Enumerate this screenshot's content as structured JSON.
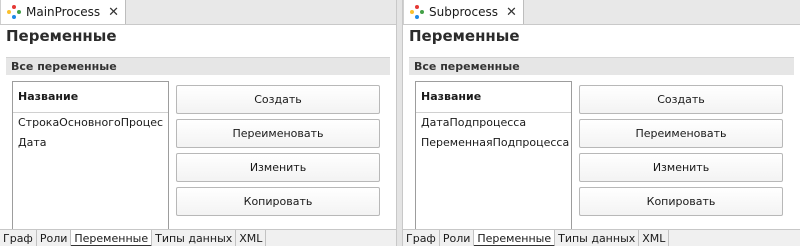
{
  "panes": {
    "left": {
      "tab_title": "MainProcess",
      "close_glyph": "✕",
      "section_title": "Переменные",
      "group_title": "Все переменные",
      "table": {
        "header": "Название",
        "rows": [
          "СтрокаОсновногоПроцес",
          "Дата"
        ]
      },
      "buttons": [
        "Создать",
        "Переименовать",
        "Изменить",
        "Копировать"
      ],
      "bottom_tabs": [
        "Граф",
        "Роли",
        "Переменные",
        "Типы данных",
        "XML"
      ],
      "active_bottom_tab": "Переменные"
    },
    "right": {
      "tab_title": "Subprocess",
      "close_glyph": "✕",
      "section_title": "Переменные",
      "group_title": "Все переменные",
      "table": {
        "header": "Название",
        "rows": [
          "ДатаПодпроцесса",
          "ПеременнаяПодпроцесса"
        ]
      },
      "buttons": [
        "Создать",
        "Переименовать",
        "Изменить",
        "Копировать"
      ],
      "bottom_tabs": [
        "Граф",
        "Роли",
        "Переменные",
        "Типы данных",
        "XML"
      ],
      "active_bottom_tab": "Переменные"
    }
  },
  "icons": {
    "tab": "process-icon",
    "close": "close-icon"
  },
  "colors": {
    "icon_dots": [
      "#e53935",
      "#43a047",
      "#1e88e5",
      "#fbc02d"
    ]
  }
}
